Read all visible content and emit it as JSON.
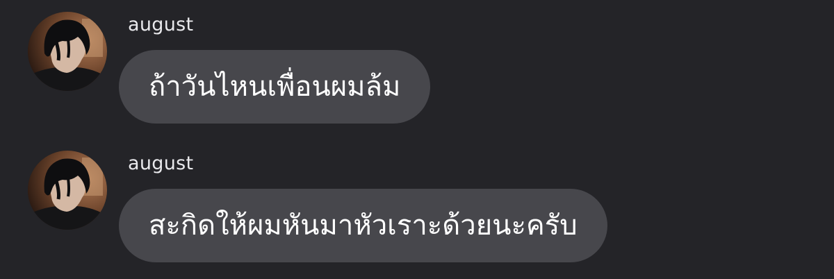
{
  "messages": [
    {
      "sender": "august",
      "text": "ถ้าวันไหนเพื่อนผมล้ม"
    },
    {
      "sender": "august",
      "text": "สะกิดให้ผมหันมาหัวเราะด้วยนะครับ"
    }
  ],
  "colors": {
    "background": "#242428",
    "bubble": "#47474c",
    "text": "#ffffff",
    "sender_name": "#e9e9ec"
  },
  "icons": {
    "avatar": "profile-photo"
  }
}
